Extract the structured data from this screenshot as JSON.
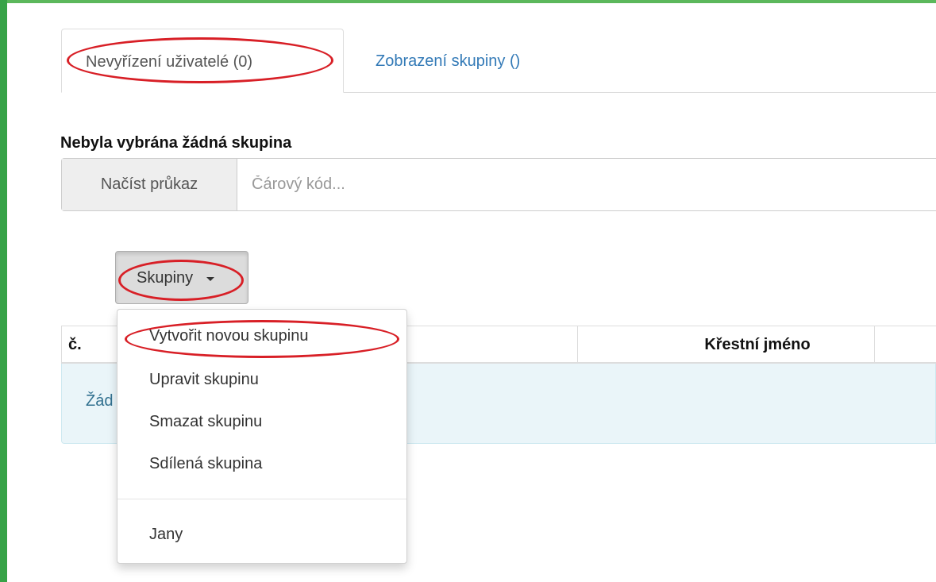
{
  "tabs": [
    {
      "label": "Nevyřízení uživatelé (0)",
      "active": true
    },
    {
      "label": "Zobrazení skupiny ()",
      "active": false
    }
  ],
  "group_status": "Nebyla vybrána žádná skupina",
  "card_reader": {
    "button_label": "Načíst průkaz",
    "placeholder": "Čárový kód..."
  },
  "groups_dropdown": {
    "button_label": "Skupiny",
    "items": [
      "Vytvořit novou skupinu",
      "Upravit skupinu",
      "Smazat skupinu",
      "Sdílená skupina"
    ],
    "extra_items": [
      "Jany"
    ]
  },
  "table": {
    "headers": [
      "č.",
      "",
      "Křestní jméno"
    ],
    "empty_text": "Žád"
  },
  "colors": {
    "frame": "#37a347",
    "highlight": "#d81f26",
    "link": "#337ab7",
    "info_bg": "#eaf5f9"
  }
}
